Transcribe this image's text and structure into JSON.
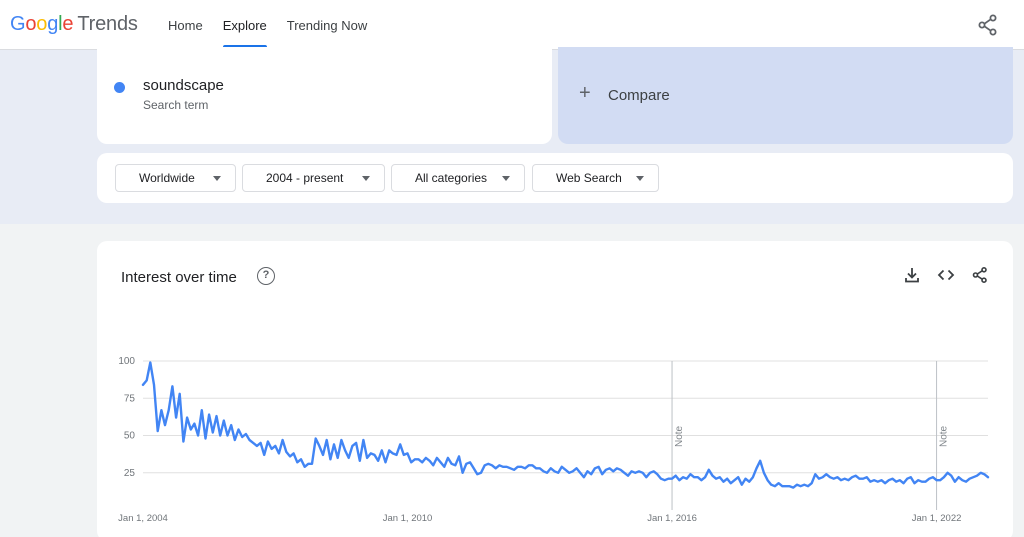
{
  "header": {
    "logo_letters": [
      {
        "ch": "G",
        "color": "#4285f4"
      },
      {
        "ch": "o",
        "color": "#ea4335"
      },
      {
        "ch": "o",
        "color": "#fbbc05"
      },
      {
        "ch": "g",
        "color": "#4285f4"
      },
      {
        "ch": "l",
        "color": "#34a853"
      },
      {
        "ch": "e",
        "color": "#ea4335"
      }
    ],
    "logo_suffix": "Trends",
    "nav": [
      "Home",
      "Explore",
      "Trending Now"
    ],
    "active_nav": "Explore",
    "share_icon": "share-icon"
  },
  "search": {
    "term": "soundscape",
    "term_sub": "Search term",
    "term_color": "#4285f4",
    "compare_label": "Compare"
  },
  "filters": {
    "region": "Worldwide",
    "time": "2004 - present",
    "category": "All categories",
    "property": "Web Search"
  },
  "chart_card": {
    "title": "Interest over time",
    "help_icon": "help-icon",
    "actions": [
      "download-icon",
      "embed-icon",
      "share-icon"
    ]
  },
  "chart_data": {
    "type": "line",
    "series": [
      {
        "values": [
          84,
          87,
          99,
          84,
          53,
          67,
          57,
          67,
          83,
          62,
          78,
          46,
          62,
          54,
          58,
          50,
          67,
          48,
          64,
          52,
          63,
          50,
          60,
          50,
          57,
          47,
          54,
          49,
          51,
          47,
          45,
          43,
          45,
          37,
          46,
          41,
          43,
          38,
          47,
          39,
          36,
          38,
          32,
          34,
          29,
          31,
          31,
          48,
          43,
          37,
          47,
          34,
          44,
          35,
          47,
          40,
          35,
          43,
          45,
          33,
          47,
          35,
          38,
          37,
          33,
          40,
          32,
          40,
          38,
          37,
          44,
          37,
          38,
          32,
          34,
          34,
          32,
          35,
          33,
          30,
          35,
          32,
          29,
          35,
          31,
          30,
          36,
          25,
          31,
          32,
          28,
          24,
          25,
          30,
          31,
          30,
          28,
          30,
          29,
          29,
          28,
          27,
          29,
          29,
          28,
          30,
          30,
          28,
          28,
          26,
          25,
          28,
          26,
          25,
          29,
          27,
          25,
          26,
          28,
          25,
          22,
          26,
          24,
          28,
          29,
          24,
          27,
          28,
          26,
          28,
          27,
          25,
          23,
          26,
          25,
          26,
          25,
          22,
          25,
          26,
          24,
          21,
          20,
          21,
          21,
          23,
          20,
          22,
          21,
          24,
          22,
          22,
          20,
          22,
          27,
          23,
          21,
          22,
          19,
          21,
          18,
          20,
          22,
          17,
          21,
          19,
          22,
          28,
          33,
          25,
          20,
          17,
          16,
          18,
          16,
          16,
          16,
          15,
          17,
          16,
          17,
          16,
          18,
          24,
          21,
          22,
          24,
          22,
          21,
          22,
          20,
          21,
          20,
          22,
          23,
          21,
          21,
          22,
          19,
          20,
          19,
          20,
          18,
          20,
          21,
          19,
          20,
          18,
          21,
          22,
          18,
          20,
          19,
          19,
          21,
          22,
          20,
          20,
          22,
          25,
          23,
          19,
          22,
          20,
          19,
          21,
          22,
          23,
          25,
          24,
          22
        ]
      }
    ],
    "x_start": "Jan 1, 2004",
    "x_step": "1 month",
    "x_tick_labels": [
      "Jan 1, 2004",
      "Jan 1, 2010",
      "Jan 1, 2016",
      "Jan 1, 2022"
    ],
    "y_ticks": [
      25,
      50,
      75,
      100
    ],
    "ylim": [
      0,
      100
    ],
    "notes": [
      {
        "x": "Jan 1, 2016",
        "label": "Note"
      },
      {
        "x": "Jan 1, 2022",
        "label": "Note"
      }
    ],
    "grid": true,
    "line_color": "#4285f4"
  }
}
